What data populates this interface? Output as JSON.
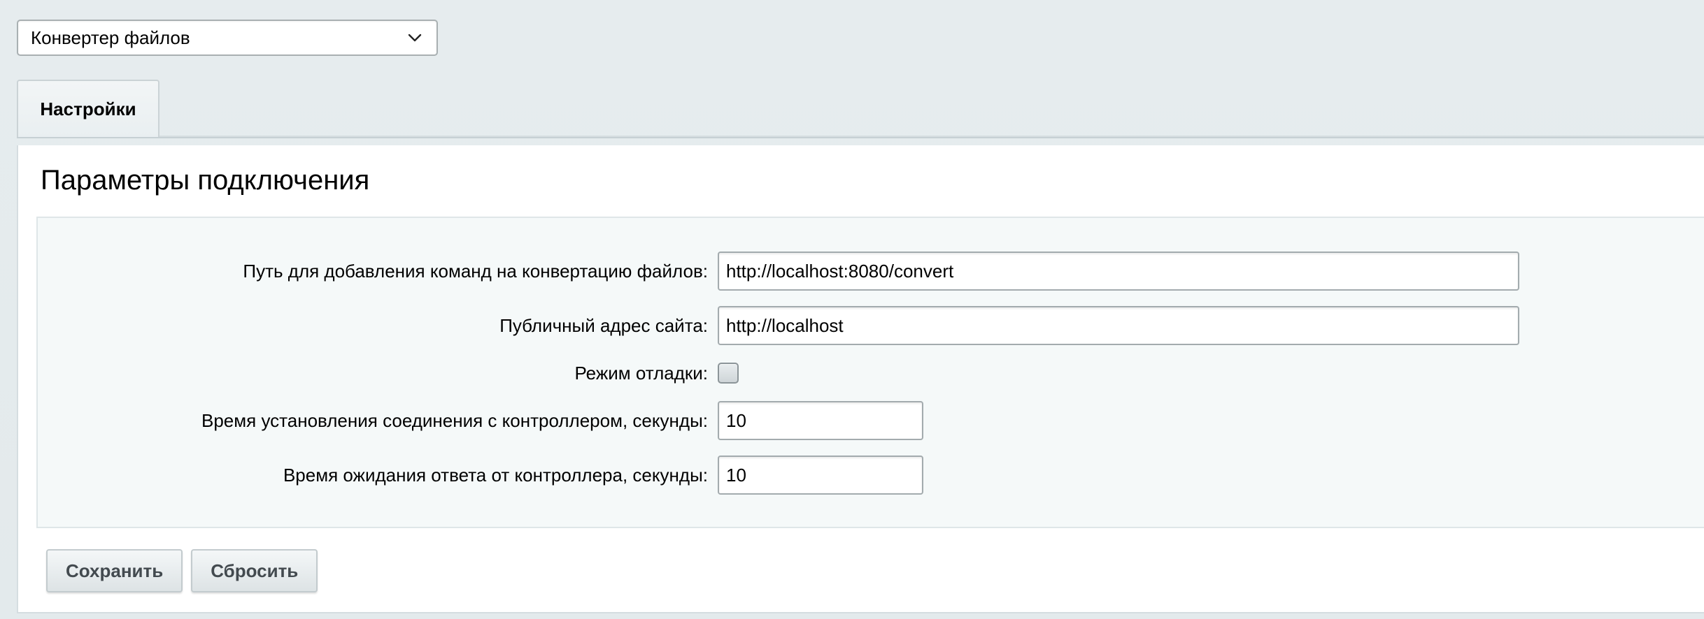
{
  "module_selector": {
    "selected": "Конвертер файлов",
    "icon": "chevron-down-icon"
  },
  "tabs": [
    {
      "label": "Настройки",
      "active": true
    }
  ],
  "section": {
    "title": "Параметры подключения"
  },
  "form": {
    "convert_path": {
      "label": "Путь для добавления команд на конвертацию файлов:",
      "value": "http://localhost:8080/convert"
    },
    "public_url": {
      "label": "Публичный адрес сайта:",
      "value": "http://localhost"
    },
    "debug_mode": {
      "label": "Режим отладки:",
      "checked": false
    },
    "connect_timeout": {
      "label": "Время установления соединения с контроллером, секунды:",
      "value": "10"
    },
    "response_timeout": {
      "label": "Время ожидания ответа от контроллера, секунды:",
      "value": "10"
    }
  },
  "actions": {
    "save_label": "Сохранить",
    "reset_label": "Сбросить"
  },
  "colors": {
    "page_background": "#e6ecee",
    "panel_background": "#ffffff",
    "form_background": "#f5f9f9",
    "button_text": "#434a4f"
  }
}
